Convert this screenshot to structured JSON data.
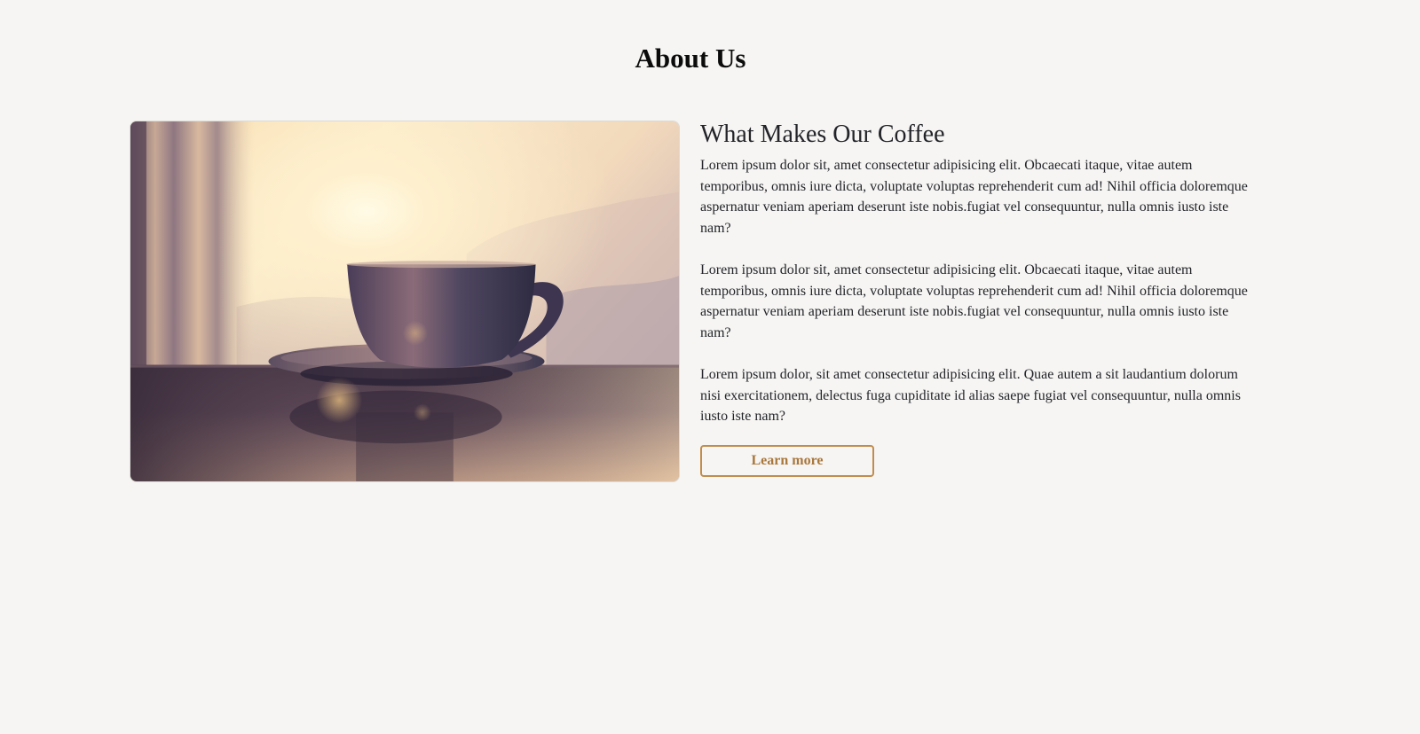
{
  "page": {
    "title": "About Us"
  },
  "about": {
    "image_subject": "coffee-cup-on-saucer-at-sunrise",
    "heading": "What Makes Our Coffee",
    "paragraphs": [
      "Lorem ipsum dolor sit, amet consectetur adipisicing elit. Obcaecati itaque, vitae autem temporibus, omnis iure dicta, voluptate voluptas reprehenderit cum ad! Nihil officia doloremque aspernatur veniam aperiam deserunt iste nobis.fugiat vel consequuntur, nulla omnis iusto iste nam?",
      "Lorem ipsum dolor sit, amet consectetur adipisicing elit. Obcaecati itaque, vitae autem temporibus, omnis iure dicta, voluptate voluptas reprehenderit cum ad! Nihil officia doloremque aspernatur veniam aperiam deserunt iste nobis.fugiat vel consequuntur, nulla omnis iusto iste nam?",
      "Lorem ipsum dolor, sit amet consectetur adipisicing elit. Quae autem a sit laudantium dolorum nisi exercitationem, delectus fuga cupiditate id alias saepe fugiat vel consequuntur, nulla omnis iusto iste nam?"
    ],
    "button_label": "Learn more"
  },
  "colors": {
    "background": "#f6f5f3",
    "accent": "#c08d4c",
    "text": "#23252a"
  }
}
